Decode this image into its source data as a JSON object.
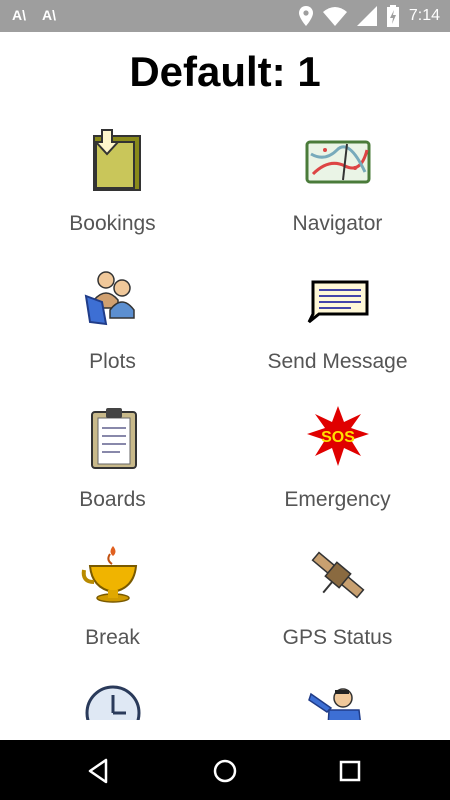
{
  "status_bar": {
    "time": "7:14",
    "icons": [
      "notification-a-icon",
      "notification-a-icon",
      "location-icon",
      "wifi-icon",
      "cellular-signal-icon",
      "battery-charging-icon"
    ]
  },
  "page_title": "Default: 1",
  "menu": {
    "items": [
      {
        "label": "Bookings",
        "icon": "bookings-icon"
      },
      {
        "label": "Navigator",
        "icon": "map-icon"
      },
      {
        "label": "Plots",
        "icon": "people-group-icon"
      },
      {
        "label": "Send Message",
        "icon": "message-icon"
      },
      {
        "label": "Boards",
        "icon": "clipboard-icon"
      },
      {
        "label": "Emergency",
        "icon": "sos-icon"
      },
      {
        "label": "Break",
        "icon": "cup-icon"
      },
      {
        "label": "GPS Status",
        "icon": "satellite-icon"
      },
      {
        "label": "",
        "icon": "clock-icon"
      },
      {
        "label": "",
        "icon": "waving-person-icon"
      }
    ]
  },
  "nav_bar": {
    "buttons": [
      "back-icon",
      "home-icon",
      "recents-icon"
    ]
  },
  "colors": {
    "status_bar": "#9e9e9e",
    "nav_bar": "#000000",
    "label_text": "#555555",
    "title_text": "#000000"
  }
}
